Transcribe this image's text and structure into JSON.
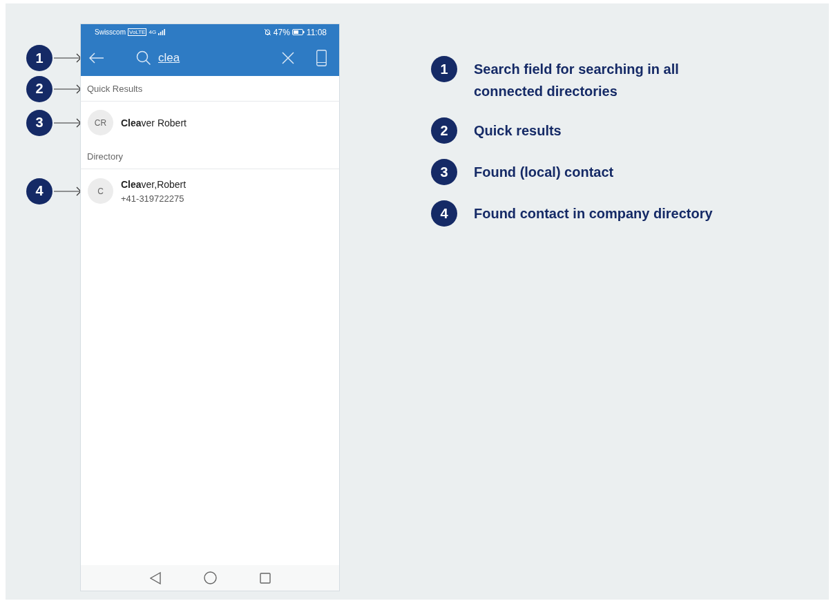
{
  "status_bar": {
    "carrier": "Swisscom",
    "volte": "VoLTE",
    "network": "4G",
    "battery": "47%",
    "time": "11:08"
  },
  "search": {
    "value": "clea",
    "callout": "1"
  },
  "sections": [
    {
      "title": "Quick Results",
      "callout": "2",
      "contacts": [
        {
          "initials": "CR",
          "name": "**Clea**ver Robert",
          "callout": "3"
        }
      ]
    },
    {
      "title": "Directory",
      "contacts": [
        {
          "initials": "C",
          "name": "**Clea**ver,Robert",
          "phone": "+41-319722275",
          "callout": "4"
        }
      ]
    }
  ],
  "legend": [
    {
      "number": "1",
      "text": "Search field for searching in all connected directories"
    },
    {
      "number": "2",
      "text": "Quick results"
    },
    {
      "number": "3",
      "text": "Found (local) contact"
    },
    {
      "number": "4",
      "text": "Found contact in company directory"
    }
  ]
}
